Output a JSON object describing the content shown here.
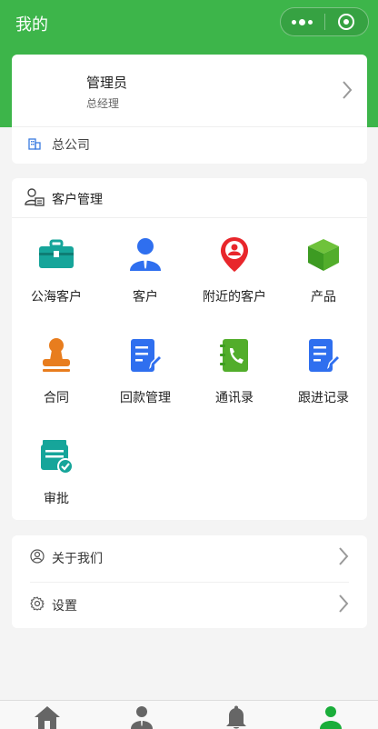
{
  "nav": {
    "title": "我的"
  },
  "profile": {
    "name": "管理员",
    "role": "总经理",
    "company": "总公司"
  },
  "crm": {
    "title": "客户管理",
    "items": [
      {
        "label": "公海客户",
        "icon": "briefcase-icon"
      },
      {
        "label": "客户",
        "icon": "person-icon"
      },
      {
        "label": "附近的客户",
        "icon": "location-pin-icon"
      },
      {
        "label": "产品",
        "icon": "box-icon"
      },
      {
        "label": "合同",
        "icon": "stamp-icon"
      },
      {
        "label": "回款管理",
        "icon": "document-edit-icon"
      },
      {
        "label": "通讯录",
        "icon": "phonebook-icon"
      },
      {
        "label": "跟进记录",
        "icon": "document-edit-icon"
      },
      {
        "label": "审批",
        "icon": "approval-icon"
      }
    ]
  },
  "settings": {
    "items": [
      {
        "label": "关于我们",
        "icon": "user-circle-icon"
      },
      {
        "label": "设置",
        "icon": "gear-icon"
      }
    ]
  },
  "tabbar": {
    "tabs": [
      {
        "icon": "home-icon",
        "active": false
      },
      {
        "icon": "contacts-icon",
        "active": false
      },
      {
        "icon": "bell-icon",
        "active": false
      },
      {
        "icon": "user-icon",
        "active": true
      }
    ]
  },
  "colors": {
    "brand_green": "#3db54a",
    "teal": "#16a59a",
    "blue": "#2f6fef",
    "red": "#e8262b",
    "orange": "#e87d1e",
    "tab_inactive": "#666666",
    "tab_active": "#1aad3a"
  }
}
